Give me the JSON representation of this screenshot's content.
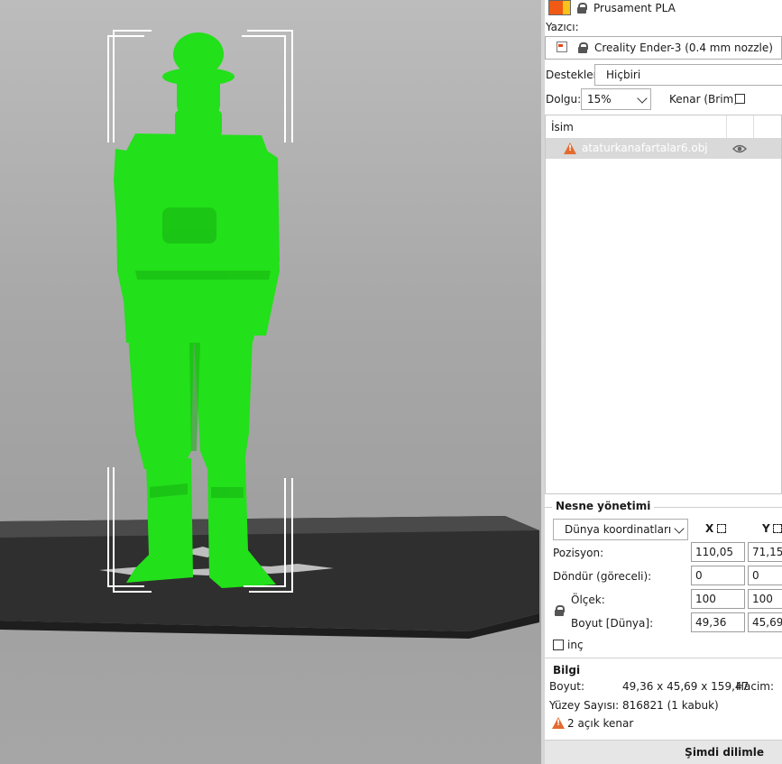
{
  "viewport": {
    "model_color": "#22e01a",
    "bed_color": "#3a3a3a",
    "background": "#a8a8a8"
  },
  "filament": {
    "name": "Prusament PLA",
    "swatch_colors": [
      "#f05a14",
      "#f7c21b"
    ]
  },
  "printer": {
    "label": "Yazıcı:",
    "name": "Creality Ender-3 (0.4 mm nozzle)"
  },
  "supports": {
    "label": "Destekler:",
    "value": "Hiçbiri"
  },
  "infill": {
    "label": "Dolgu:",
    "value": "15%"
  },
  "brim": {
    "label": "Kenar (Brim):"
  },
  "object_list": {
    "header": "İsim",
    "items": [
      {
        "name": "ataturkanafartalar6.obj",
        "warning": true
      }
    ]
  },
  "object_manipulation": {
    "title": "Nesne yönetimi",
    "coordinate_system": "Dünya koordinatları",
    "axes": [
      "X",
      "Y"
    ],
    "rows": [
      {
        "label": "Pozisyon:",
        "x": "110,05",
        "y": "71,15"
      },
      {
        "label": "Döndür (göreceli):",
        "x": "0",
        "y": "0"
      },
      {
        "label": "Ölçek:",
        "x": "100",
        "y": "100"
      },
      {
        "label": "Boyut [Dünya]:",
        "x": "49,36",
        "y": "45,69"
      }
    ],
    "inch_label": "inç"
  },
  "info": {
    "title": "Bilgi",
    "size_label": "Boyut:",
    "size_value": "49,36 x 45,69 x 159,47",
    "volume_label": "Hacim:",
    "facets_label": "Yüzey Sayısı:",
    "facets_value": "816821 (1 kabuk)",
    "warning_text": "2 açık kenar"
  },
  "slice_button": {
    "label": "Şimdi dilimle"
  }
}
